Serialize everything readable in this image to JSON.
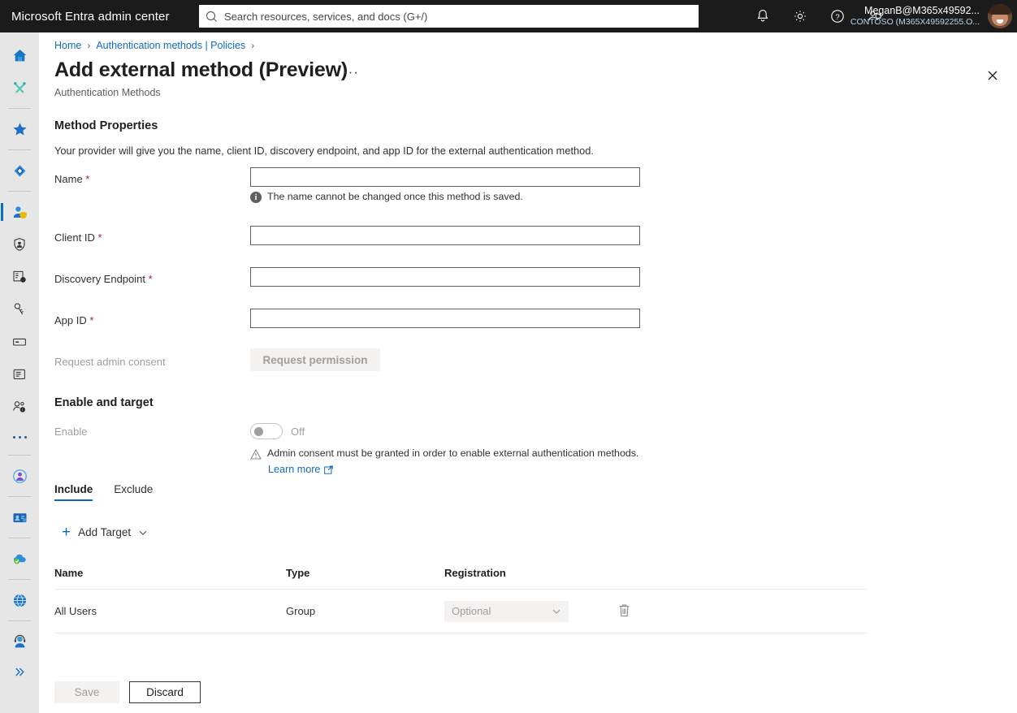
{
  "topbar": {
    "brand": "Microsoft Entra admin center",
    "search": {
      "placeholder": "Search resources, services, and docs (G+/)",
      "value": "",
      "icon": "search-icon"
    },
    "icons": [
      {
        "name": "notifications-icon",
        "label": "Notifications"
      },
      {
        "name": "settings-gear-icon",
        "label": "Settings"
      },
      {
        "name": "help-question-icon",
        "label": "Help"
      },
      {
        "name": "feedback-icon",
        "label": "Feedback"
      }
    ],
    "user": {
      "account": "MeganB@M365x49592...",
      "tenant": "CONTOSO (M365X49592255.O..."
    }
  },
  "rail": {
    "items": [
      {
        "name": "home-icon",
        "label": "Home",
        "selected": false
      },
      {
        "name": "diagnose-tools-icon",
        "label": "Diagnose & solve problems",
        "selected": false
      },
      {
        "name": "favorites-star-icon",
        "label": "Favorites",
        "selected": false
      },
      {
        "name": "identity-diamond-icon",
        "label": "Identity",
        "selected": false
      },
      {
        "name": "protection-user-shield-icon",
        "label": "Protection",
        "selected": true
      },
      {
        "name": "identity-governance-icon",
        "label": "Identity governance",
        "selected": false
      },
      {
        "name": "verified-id-card-icon",
        "label": "Verified ID",
        "selected": false
      },
      {
        "name": "permissions-key-icon",
        "label": "Permissions management",
        "selected": false
      },
      {
        "name": "billing-card-icon",
        "label": "Billing",
        "selected": false
      },
      {
        "name": "reports-document-icon",
        "label": "Reports",
        "selected": false
      },
      {
        "name": "support-people-icon",
        "label": "Support",
        "selected": false
      },
      {
        "name": "more-dots-icon",
        "label": "Show more",
        "selected": false
      },
      {
        "name": "entra-id-protection-icon",
        "label": "Identity Protection",
        "selected": false
      },
      {
        "name": "entra-verified-id-icon",
        "label": "Verified ID",
        "selected": false
      },
      {
        "name": "permissions-cloud-icon",
        "label": "Permissions Management",
        "selected": false
      },
      {
        "name": "global-secure-access-icon",
        "label": "Global Secure Access",
        "selected": false
      },
      {
        "name": "learn-support-icon",
        "label": "Learn & support",
        "selected": false
      },
      {
        "name": "expand-chevron-icon",
        "label": "Expand",
        "selected": false
      }
    ]
  },
  "breadcrumb": {
    "items": [
      {
        "label": "Home",
        "link": true
      },
      {
        "label": "Authentication methods | Policies",
        "link": true
      }
    ],
    "separator": "›"
  },
  "page": {
    "title": "Add external method (Preview)",
    "ellipsis": "···",
    "subtitle": "Authentication Methods",
    "close_icon": "close-icon"
  },
  "method_properties": {
    "heading": "Method Properties",
    "description": "Your provider will give you the name, client ID, discovery endpoint, and app ID for the external authentication method.",
    "fields": [
      {
        "label": "Name",
        "required": true,
        "value": "",
        "placeholder": ""
      },
      {
        "label": "Client ID",
        "required": true,
        "value": "",
        "placeholder": ""
      },
      {
        "label": "Discovery Endpoint",
        "required": true,
        "value": "",
        "placeholder": ""
      },
      {
        "label": "App ID",
        "required": true,
        "value": "",
        "placeholder": ""
      }
    ],
    "name_hint": "The name cannot be changed once this method is saved.",
    "name_hint_icon": "info-icon",
    "consent_label": "Request admin consent",
    "consent_button": "Request permission",
    "consent_button_disabled": true
  },
  "enable_and_target": {
    "heading": "Enable and target",
    "enable_label": "Enable",
    "toggle_state": "Off",
    "toggle_on": false,
    "warning_icon": "warning-triangle-icon",
    "warning_text": "Admin consent must be granted in order to enable external authentication methods.",
    "learn_more": "Learn more",
    "learn_more_icon": "external-link-icon"
  },
  "target_tabs": {
    "tabs": [
      {
        "label": "Include",
        "active": true
      },
      {
        "label": "Exclude",
        "active": false
      }
    ],
    "add_target": {
      "label": "Add Target",
      "plus_icon": "plus-icon",
      "chevron_icon": "chevron-down-icon"
    }
  },
  "target_table": {
    "columns": [
      "Name",
      "Type",
      "Registration"
    ],
    "rows": [
      {
        "name": "All Users",
        "type": "Group",
        "registration": "Optional",
        "registration_disabled": true,
        "delete_icon": "trash-icon"
      }
    ]
  },
  "footer": {
    "save_label": "Save",
    "save_disabled": true,
    "discard_label": "Discard"
  },
  "colors": {
    "accent": "#0f6cbd",
    "topbar_bg": "#1b1b1b",
    "rail_bg": "#e6e6e6",
    "required_star": "#a4262c",
    "disabled_text": "#a19f9d",
    "disabled_bg": "#f3f2f1"
  }
}
